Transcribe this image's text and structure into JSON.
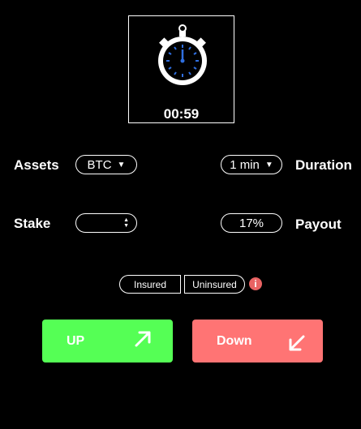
{
  "timer": {
    "value": "00:59",
    "icon": "stopwatch-icon"
  },
  "assets": {
    "label": "Assets",
    "selected": "BTC"
  },
  "duration": {
    "label": "Duration",
    "selected": "1 min"
  },
  "stake": {
    "label": "Stake",
    "value": ""
  },
  "payout": {
    "label": "Payout",
    "value": "17%"
  },
  "insurance": {
    "insured_label": "Insured",
    "uninsured_label": "Uninsured",
    "info_icon": "info-icon"
  },
  "actions": {
    "up_label": "UP",
    "up_color": "#55ff55",
    "up_icon": "arrow-up-right-icon",
    "down_label": "Down",
    "down_color": "#ff7474",
    "down_icon": "arrow-down-left-icon"
  }
}
